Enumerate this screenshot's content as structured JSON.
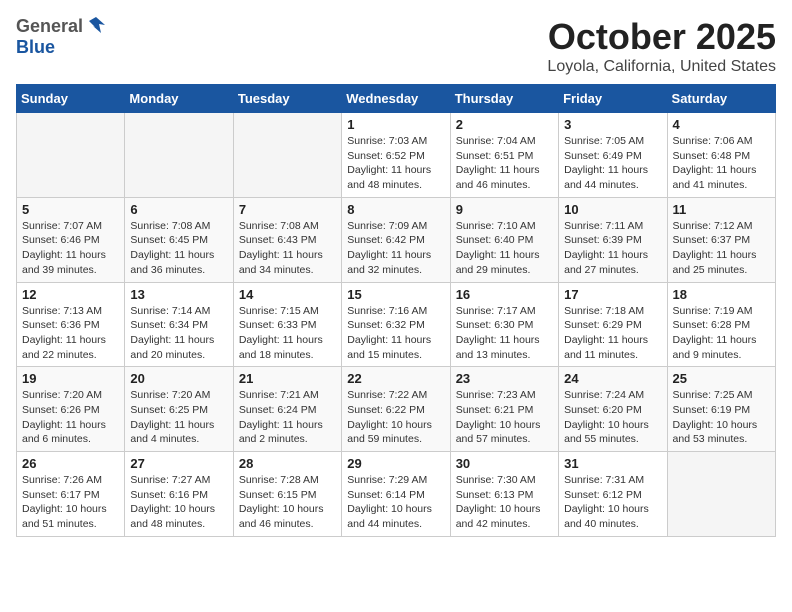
{
  "logo": {
    "general": "General",
    "blue": "Blue"
  },
  "header": {
    "month": "October 2025",
    "location": "Loyola, California, United States"
  },
  "weekdays": [
    "Sunday",
    "Monday",
    "Tuesday",
    "Wednesday",
    "Thursday",
    "Friday",
    "Saturday"
  ],
  "rows": [
    [
      {
        "day": "",
        "text": "",
        "empty": true
      },
      {
        "day": "",
        "text": "",
        "empty": true
      },
      {
        "day": "",
        "text": "",
        "empty": true
      },
      {
        "day": "1",
        "text": "Sunrise: 7:03 AM\nSunset: 6:52 PM\nDaylight: 11 hours and 48 minutes."
      },
      {
        "day": "2",
        "text": "Sunrise: 7:04 AM\nSunset: 6:51 PM\nDaylight: 11 hours and 46 minutes."
      },
      {
        "day": "3",
        "text": "Sunrise: 7:05 AM\nSunset: 6:49 PM\nDaylight: 11 hours and 44 minutes."
      },
      {
        "day": "4",
        "text": "Sunrise: 7:06 AM\nSunset: 6:48 PM\nDaylight: 11 hours and 41 minutes."
      }
    ],
    [
      {
        "day": "5",
        "text": "Sunrise: 7:07 AM\nSunset: 6:46 PM\nDaylight: 11 hours and 39 minutes."
      },
      {
        "day": "6",
        "text": "Sunrise: 7:08 AM\nSunset: 6:45 PM\nDaylight: 11 hours and 36 minutes."
      },
      {
        "day": "7",
        "text": "Sunrise: 7:08 AM\nSunset: 6:43 PM\nDaylight: 11 hours and 34 minutes."
      },
      {
        "day": "8",
        "text": "Sunrise: 7:09 AM\nSunset: 6:42 PM\nDaylight: 11 hours and 32 minutes."
      },
      {
        "day": "9",
        "text": "Sunrise: 7:10 AM\nSunset: 6:40 PM\nDaylight: 11 hours and 29 minutes."
      },
      {
        "day": "10",
        "text": "Sunrise: 7:11 AM\nSunset: 6:39 PM\nDaylight: 11 hours and 27 minutes."
      },
      {
        "day": "11",
        "text": "Sunrise: 7:12 AM\nSunset: 6:37 PM\nDaylight: 11 hours and 25 minutes."
      }
    ],
    [
      {
        "day": "12",
        "text": "Sunrise: 7:13 AM\nSunset: 6:36 PM\nDaylight: 11 hours and 22 minutes."
      },
      {
        "day": "13",
        "text": "Sunrise: 7:14 AM\nSunset: 6:34 PM\nDaylight: 11 hours and 20 minutes."
      },
      {
        "day": "14",
        "text": "Sunrise: 7:15 AM\nSunset: 6:33 PM\nDaylight: 11 hours and 18 minutes."
      },
      {
        "day": "15",
        "text": "Sunrise: 7:16 AM\nSunset: 6:32 PM\nDaylight: 11 hours and 15 minutes."
      },
      {
        "day": "16",
        "text": "Sunrise: 7:17 AM\nSunset: 6:30 PM\nDaylight: 11 hours and 13 minutes."
      },
      {
        "day": "17",
        "text": "Sunrise: 7:18 AM\nSunset: 6:29 PM\nDaylight: 11 hours and 11 minutes."
      },
      {
        "day": "18",
        "text": "Sunrise: 7:19 AM\nSunset: 6:28 PM\nDaylight: 11 hours and 9 minutes."
      }
    ],
    [
      {
        "day": "19",
        "text": "Sunrise: 7:20 AM\nSunset: 6:26 PM\nDaylight: 11 hours and 6 minutes."
      },
      {
        "day": "20",
        "text": "Sunrise: 7:20 AM\nSunset: 6:25 PM\nDaylight: 11 hours and 4 minutes."
      },
      {
        "day": "21",
        "text": "Sunrise: 7:21 AM\nSunset: 6:24 PM\nDaylight: 11 hours and 2 minutes."
      },
      {
        "day": "22",
        "text": "Sunrise: 7:22 AM\nSunset: 6:22 PM\nDaylight: 10 hours and 59 minutes."
      },
      {
        "day": "23",
        "text": "Sunrise: 7:23 AM\nSunset: 6:21 PM\nDaylight: 10 hours and 57 minutes."
      },
      {
        "day": "24",
        "text": "Sunrise: 7:24 AM\nSunset: 6:20 PM\nDaylight: 10 hours and 55 minutes."
      },
      {
        "day": "25",
        "text": "Sunrise: 7:25 AM\nSunset: 6:19 PM\nDaylight: 10 hours and 53 minutes."
      }
    ],
    [
      {
        "day": "26",
        "text": "Sunrise: 7:26 AM\nSunset: 6:17 PM\nDaylight: 10 hours and 51 minutes."
      },
      {
        "day": "27",
        "text": "Sunrise: 7:27 AM\nSunset: 6:16 PM\nDaylight: 10 hours and 48 minutes."
      },
      {
        "day": "28",
        "text": "Sunrise: 7:28 AM\nSunset: 6:15 PM\nDaylight: 10 hours and 46 minutes."
      },
      {
        "day": "29",
        "text": "Sunrise: 7:29 AM\nSunset: 6:14 PM\nDaylight: 10 hours and 44 minutes."
      },
      {
        "day": "30",
        "text": "Sunrise: 7:30 AM\nSunset: 6:13 PM\nDaylight: 10 hours and 42 minutes."
      },
      {
        "day": "31",
        "text": "Sunrise: 7:31 AM\nSunset: 6:12 PM\nDaylight: 10 hours and 40 minutes."
      },
      {
        "day": "",
        "text": "",
        "empty": true
      }
    ]
  ]
}
